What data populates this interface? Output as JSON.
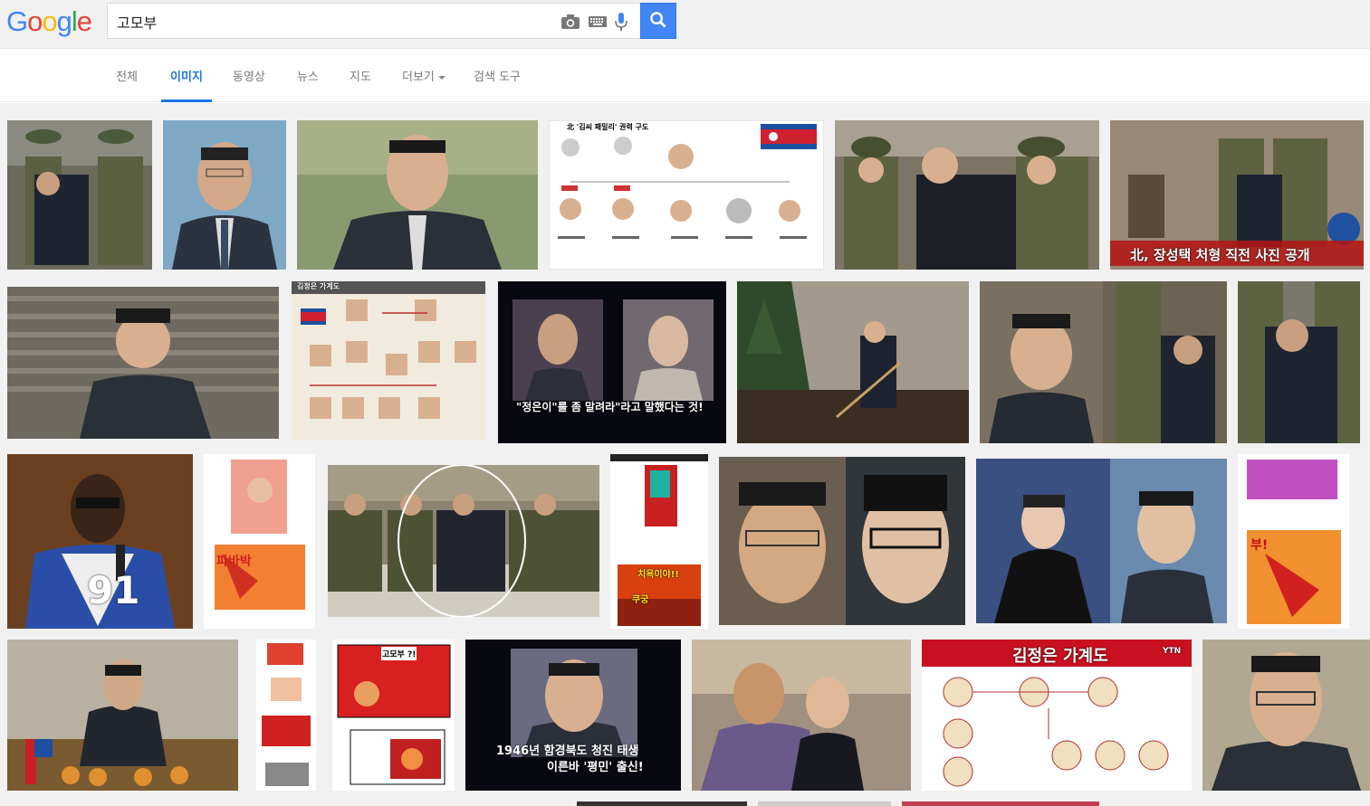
{
  "header": {
    "logo_letters": [
      "G",
      "o",
      "o",
      "g",
      "l",
      "e"
    ],
    "logo_colors": [
      "#4285f4",
      "#ea4335",
      "#fbbc05",
      "#4285f4",
      "#34a853",
      "#ea4335"
    ],
    "search_value": "고모부",
    "icons": [
      "camera-icon",
      "keyboard-icon",
      "microphone-icon",
      "search-icon"
    ]
  },
  "nav": {
    "tabs": [
      {
        "label": "전체"
      },
      {
        "label": "이미지"
      },
      {
        "label": "동영상"
      },
      {
        "label": "뉴스"
      },
      {
        "label": "지도"
      },
      {
        "label": "더보기"
      },
      {
        "label": "검색 도구"
      }
    ],
    "active_tab": "이미지",
    "accent_color": "#1a73e8"
  },
  "results": {
    "captions": {
      "news_banner": "北, 장성택 처형 직전 사진 공개",
      "chart_title": "北 '김씨 패밀리' 권력 구도",
      "family_tree_small": "김정은 가계도",
      "quote": "\"정은이\"를 좀 말려라\"라고 말했다는 것!",
      "jersey": "91",
      "comic_pa": "파바박",
      "comic_buk": "부!",
      "comic_gomobu": "고모부 ?!",
      "comic_chikm": "치욕이야!!",
      "comic_kung": "쿠궁",
      "subtitle_1946": "1946년 함경북도 청진 태생",
      "subtitle_pyeongmin": "이른바 '평민' 출신!",
      "family_tree_large": "김정은 가계도",
      "ytn": "YTN"
    }
  }
}
